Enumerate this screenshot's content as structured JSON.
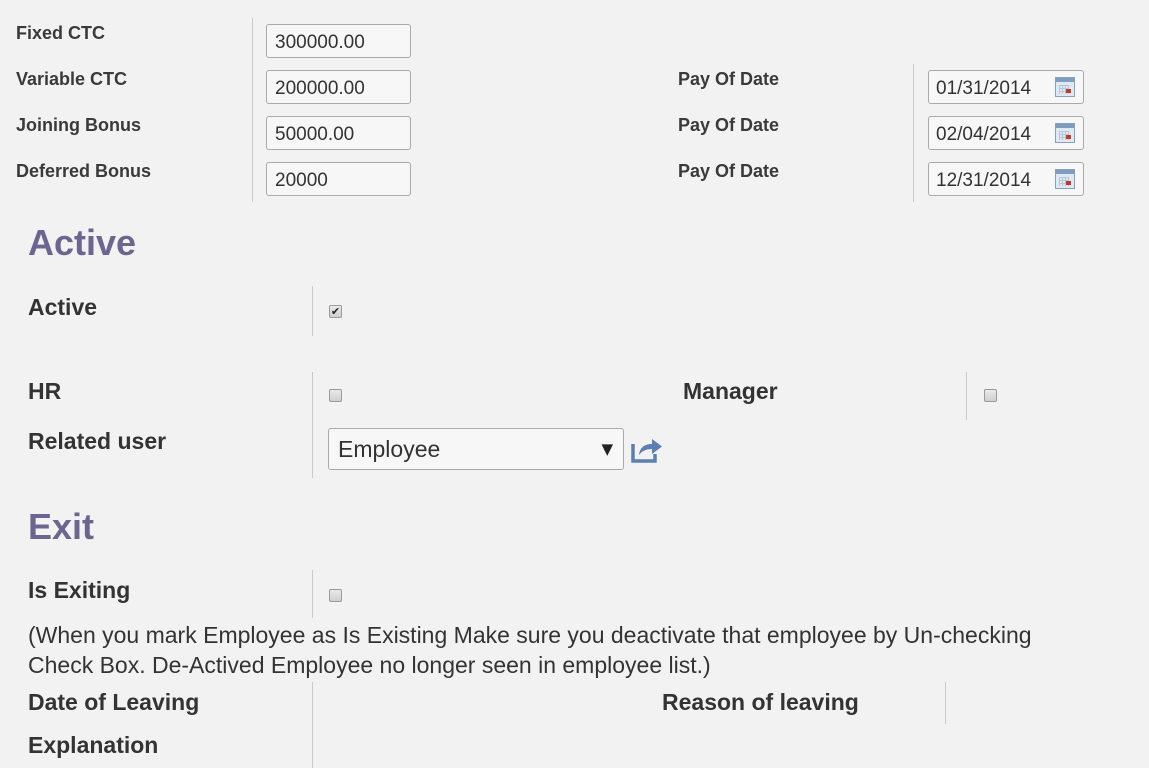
{
  "compensation": {
    "fixed_ctc": {
      "label": "Fixed CTC",
      "value": "300000.00"
    },
    "variable_ctc": {
      "label": "Variable CTC",
      "value": "200000.00",
      "pay_label": "Pay Of Date",
      "pay_date": "01/31/2014"
    },
    "joining_bonus": {
      "label": "Joining Bonus",
      "value": "50000.00",
      "pay_label": "Pay Of Date",
      "pay_date": "02/04/2014"
    },
    "deferred_bonus": {
      "label": "Deferred Bonus",
      "value": "20000",
      "pay_label": "Pay Of Date",
      "pay_date": "12/31/2014"
    }
  },
  "active_section": {
    "title": "Active",
    "active": {
      "label": "Active",
      "checked": true,
      "check_glyph": "✔"
    },
    "hr": {
      "label": "HR",
      "checked": false
    },
    "manager": {
      "label": "Manager",
      "checked": false
    },
    "related_user": {
      "label": "Related user",
      "value": "Employee",
      "arrow": "▼",
      "open_icon": "external-link-icon"
    }
  },
  "exit_section": {
    "title": "Exit",
    "is_exiting": {
      "label": "Is Exiting",
      "checked": false
    },
    "note_line1": "(When you mark Employee as Is Existing Make sure you deactivate that employee by Un-checking",
    "note_line2": "Check Box. De-Actived Employee no longer seen in employee list.)",
    "date_of_leaving": {
      "label": "Date of Leaving"
    },
    "reason_of_leaving": {
      "label": "Reason of leaving"
    },
    "explanation": {
      "label": "Explanation"
    }
  },
  "colors": {
    "section_title": "#6b6590",
    "link_icon": "#5b7fb0"
  }
}
